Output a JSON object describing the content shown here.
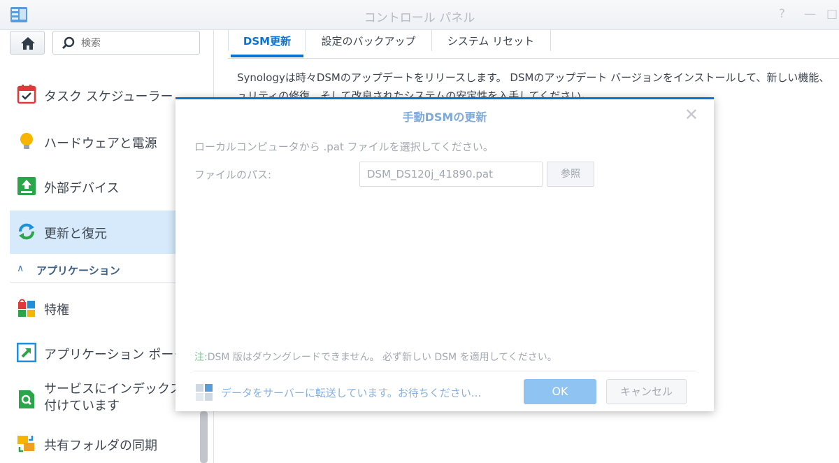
{
  "window": {
    "title": "コントロール パネル",
    "help_glyph": "?",
    "minimize_glyph": "—",
    "maximize_glyph": "□",
    "icon": "control-panel-icon"
  },
  "sidebar": {
    "home_icon": "home-icon",
    "search_placeholder": "検索",
    "items": [
      {
        "label": "タスク スケジューラー",
        "icon": "calendar-check-icon"
      },
      {
        "label": "ハードウェアと電源",
        "icon": "lightbulb-icon"
      },
      {
        "label": "外部デバイス",
        "icon": "upload-device-icon"
      },
      {
        "label": "更新と復元",
        "icon": "refresh-icon",
        "active": true
      },
      {
        "label": "特権",
        "icon": "privileges-icon"
      },
      {
        "label": "アプリケーション ポータル",
        "icon": "app-portal-icon"
      },
      {
        "label": "サービスにインデックス\n付けています",
        "icon": "indexing-icon"
      },
      {
        "label": "共有フォルダの同期",
        "icon": "folder-sync-icon"
      }
    ],
    "section_label": "アプリケーション",
    "section_chevron": "∧"
  },
  "tabs": [
    {
      "label": "DSM更新",
      "active": true
    },
    {
      "label": "設定のバックアップ"
    },
    {
      "label": "システム リセット"
    }
  ],
  "main": {
    "description": "Synologyは時々DSMのアップデートをリリースします。 DSMのアップデート バージョンをインストールして、新しい機能、",
    "description_line2": "ュリティの修復、そして改良されたシステムの安定性を入手してください。"
  },
  "dialog": {
    "title": "手動DSMの更新",
    "close_glyph": "✕",
    "intro": "ローカルコンピュータから .pat ファイルを選択してください。",
    "file_path_label": "ファイルのパス:",
    "file_path_value": "DSM_DS120j_41890.pat",
    "browse_label": "参照",
    "note_prefix": "注:",
    "note_text": "DSM 版はダウングレードできません。 必ず新しい DSM を適用してください。",
    "status_text": "データをサーバーに転送しています。お待ちください...",
    "ok_label": "OK",
    "cancel_label": "キャンセル"
  },
  "colors": {
    "accent": "#0a73d2",
    "sidebar_active": "#d6eafb",
    "ok_button": "#8ec3f2"
  }
}
